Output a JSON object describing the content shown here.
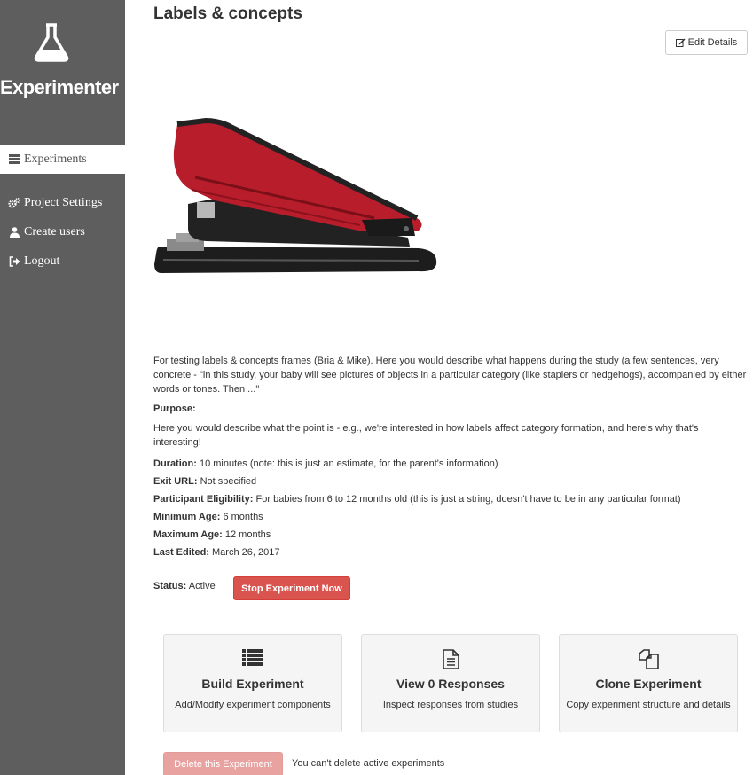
{
  "sidebar": {
    "brand": "Experimenter",
    "items": [
      {
        "label": "Experiments",
        "icon": "list-icon",
        "active": true
      },
      {
        "label": "Project Settings",
        "icon": "gears-icon"
      },
      {
        "label": "Create users",
        "icon": "user-icon"
      },
      {
        "label": "Logout",
        "icon": "sign-out-icon"
      }
    ]
  },
  "experiment": {
    "title": "Labels & concepts",
    "edit_label": "Edit Details",
    "description": "For testing labels & concepts frames (Bria & Mike). Here you would describe what happens during the study (a few sentences, very concrete - \"in this study, your baby will see pictures of objects in a particular category (like staplers or hedgehogs), accompanied by either words or tones. Then ...\"",
    "purpose_label": "Purpose:",
    "purpose": "Here you would describe what the point is - e.g., we're interested in how labels affect category formation, and here's why that's interesting!",
    "fields": [
      {
        "label": "Duration:",
        "value": "10 minutes (note: this is just an estimate, for the parent's information)"
      },
      {
        "label": "Exit URL:",
        "value": "Not specified"
      },
      {
        "label": "Participant Eligibility:",
        "value": "For babies from 6 to 12 months old (this is just a string, doesn't have to be in any particular format)"
      },
      {
        "label": "Minimum Age:",
        "value": "6 months"
      },
      {
        "label": "Maximum Age:",
        "value": "12 months"
      },
      {
        "label": "Last Edited:",
        "value": "March 26, 2017"
      }
    ],
    "status_label": "Status:",
    "status_value": "Active",
    "stop_label": "Stop Experiment Now"
  },
  "cards": [
    {
      "title": "Build Experiment",
      "subtitle": "Add/Modify experiment components",
      "icon": "list-icon"
    },
    {
      "title": "View 0 Responses",
      "subtitle": "Inspect responses from studies",
      "icon": "file-text-icon"
    },
    {
      "title": "Clone Experiment",
      "subtitle": "Copy experiment structure and details",
      "icon": "files-icon"
    }
  ],
  "delete": {
    "label": "Delete this Experiment",
    "note": "You can't delete active experiments"
  },
  "colors": {
    "sidebar": "#5e5e5e",
    "danger": "#d9534f",
    "danger_disabled": "#e8a3a1",
    "card_bg": "#f5f5f5"
  }
}
